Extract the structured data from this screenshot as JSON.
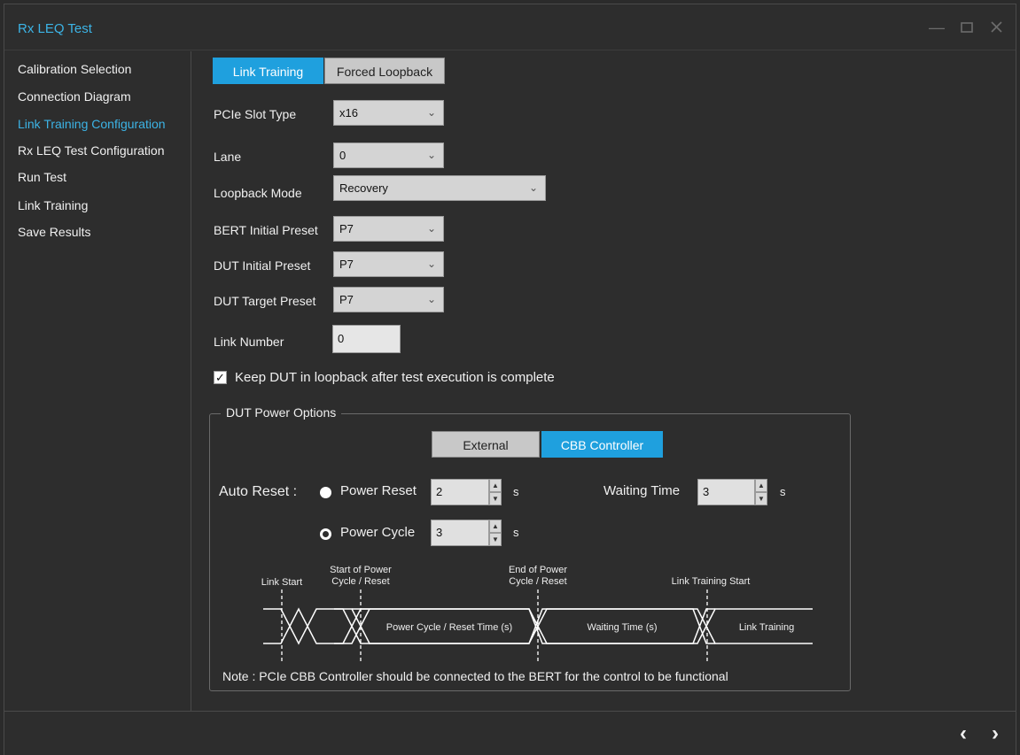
{
  "window": {
    "title": "Rx LEQ Test"
  },
  "sidebar": {
    "items": [
      {
        "label": "Calibration Selection"
      },
      {
        "label": "Connection Diagram"
      },
      {
        "label": "Link Training Configuration"
      },
      {
        "label": "Rx LEQ Test Configuration"
      },
      {
        "label": "Run Test"
      },
      {
        "label": "Link Training"
      },
      {
        "label": "Save Results"
      }
    ],
    "active_index": 2
  },
  "mode_tabs": {
    "link_training": "Link Training",
    "forced_loopback": "Forced Loopback",
    "selected": "Link Training"
  },
  "form": {
    "pcie_slot_type": {
      "label": "PCIe Slot Type",
      "value": "x16"
    },
    "lane": {
      "label": "Lane",
      "value": "0"
    },
    "loopback_mode": {
      "label": "Loopback Mode",
      "value": "Recovery"
    },
    "bert_initial_preset": {
      "label": "BERT Initial Preset",
      "value": "P7"
    },
    "dut_initial_preset": {
      "label": "DUT Initial Preset",
      "value": "P7"
    },
    "dut_target_preset": {
      "label": "DUT Target Preset",
      "value": "P7"
    },
    "link_number": {
      "label": "Link Number",
      "value": "0"
    },
    "keep_loopback": {
      "label": "Keep DUT in loopback after test execution is complete",
      "checked": true
    }
  },
  "power_options": {
    "title": "DUT Power Options",
    "tabs": {
      "external": "External",
      "cbb_controller": "CBB Controller",
      "selected": "CBB Controller"
    },
    "auto_reset_label": "Auto Reset :",
    "power_reset": {
      "label": "Power Reset",
      "value": "2",
      "unit": "s",
      "selected": true
    },
    "power_cycle": {
      "label": "Power Cycle",
      "value": "3",
      "unit": "s",
      "selected": false
    },
    "waiting_time": {
      "label": "Waiting Time",
      "value": "3",
      "unit": "s"
    },
    "diagram": {
      "link_start": "Link Start",
      "start_power_1": "Start of Power",
      "start_power_2": "Cycle / Reset",
      "end_power_1": "End of Power",
      "end_power_2": "Cycle / Reset",
      "link_training_start": "Link Training Start",
      "power_cycle_time": "Power Cycle / Reset Time (s)",
      "waiting_time": "Waiting Time (s)",
      "link_training": "Link Training"
    },
    "note": "Note :   PCIe CBB Controller should be connected to the BERT for the control to be functional"
  },
  "icons": {
    "minimize": "minimize-icon",
    "maximize": "maximize-icon",
    "close": "close-icon",
    "dropdown": "chevron-down-icon",
    "back": "chevron-left-icon",
    "forward": "chevron-right-icon"
  },
  "colors": {
    "accent": "#1fa0de",
    "active_text": "#3cb4e6",
    "background": "#2d2d2d"
  }
}
